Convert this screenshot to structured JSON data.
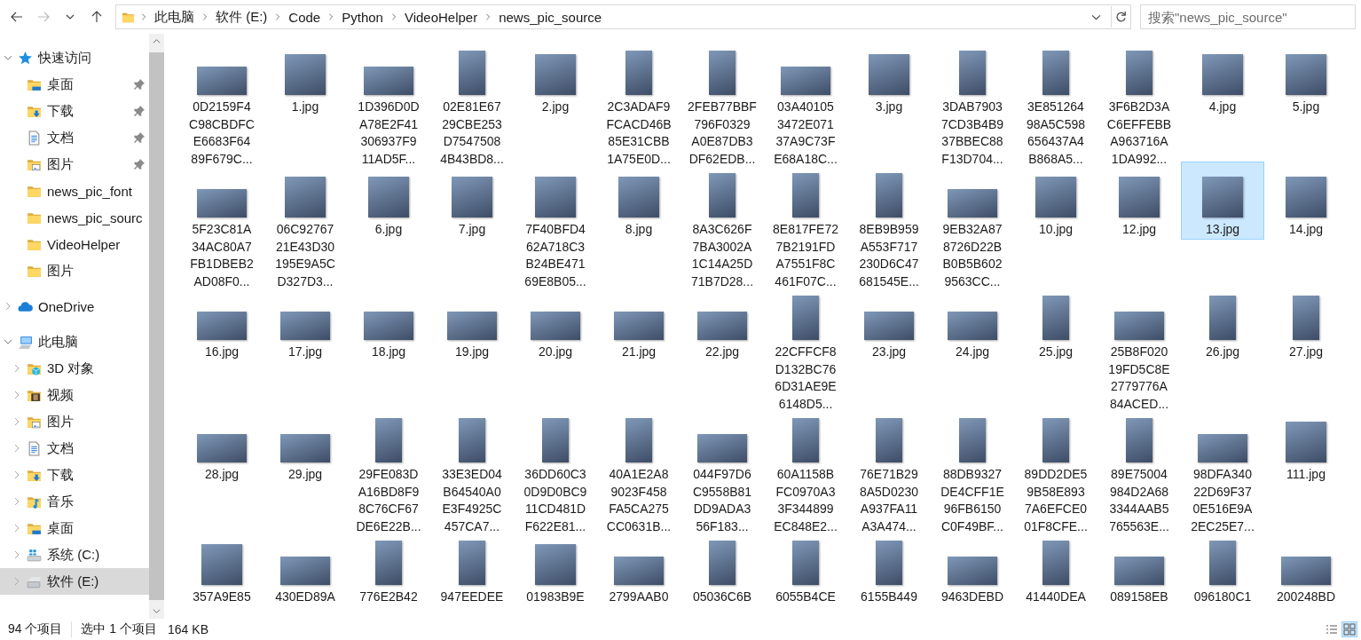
{
  "nav_buttons": [
    {
      "kind": "back",
      "disabled": false
    },
    {
      "kind": "forward",
      "disabled": true
    },
    {
      "kind": "recent",
      "disabled": false
    },
    {
      "kind": "up",
      "disabled": false
    }
  ],
  "address_bar": {
    "segments": [
      "此电脑",
      "软件 (E:)",
      "Code",
      "Python",
      "VideoHelper",
      "news_pic_source"
    ]
  },
  "search": {
    "placeholder": "搜索\"news_pic_source\""
  },
  "sidebar": {
    "sections": [
      {
        "label": "快速访问",
        "kind": "star",
        "expanded": true,
        "selected": false,
        "children": [
          {
            "label": "桌面",
            "kind": "desktop",
            "pinned": true,
            "selected": false
          },
          {
            "label": "下载",
            "kind": "downloads",
            "pinned": true,
            "selected": false
          },
          {
            "label": "文档",
            "kind": "documents",
            "pinned": true,
            "selected": false
          },
          {
            "label": "图片",
            "kind": "pictures",
            "pinned": true,
            "selected": false
          },
          {
            "label": "news_pic_font",
            "kind": "folder",
            "pinned": false,
            "selected": false
          },
          {
            "label": "news_pic_sourc",
            "kind": "folder",
            "pinned": false,
            "selected": false
          },
          {
            "label": "VideoHelper",
            "kind": "folder",
            "pinned": false,
            "selected": false
          },
          {
            "label": "图片",
            "kind": "folder",
            "pinned": false,
            "selected": false
          }
        ]
      },
      {
        "label": "OneDrive",
        "kind": "cloud",
        "expanded": false,
        "selected": false
      },
      {
        "label": "此电脑",
        "kind": "pc",
        "expanded": true,
        "selected": false,
        "children": [
          {
            "label": "3D 对象",
            "kind": "objects",
            "expanded": false,
            "selected": false
          },
          {
            "label": "视频",
            "kind": "videos",
            "expanded": false,
            "selected": false
          },
          {
            "label": "图片",
            "kind": "pictures",
            "expanded": false,
            "selected": false
          },
          {
            "label": "文档",
            "kind": "documents",
            "expanded": false,
            "selected": false
          },
          {
            "label": "下载",
            "kind": "downloads",
            "expanded": false,
            "selected": false
          },
          {
            "label": "音乐",
            "kind": "music",
            "expanded": false,
            "selected": false
          },
          {
            "label": "桌面",
            "kind": "desktop",
            "expanded": false,
            "selected": false
          },
          {
            "label": "系统 (C:)",
            "kind": "sysdrive",
            "expanded": false,
            "selected": false
          },
          {
            "label": "软件 (E:)",
            "kind": "drive",
            "expanded": false,
            "selected": true
          }
        ]
      }
    ]
  },
  "files": [
    {
      "name": "0D2159F4\nC98CBDFC\nE6683F64\n89F679C...",
      "kind": "landscape",
      "selected": false
    },
    {
      "name": "1.jpg",
      "kind": "square",
      "selected": false
    },
    {
      "name": "1D396D0D\nA78E2F41\n306937F9\n11AD5F...",
      "kind": "landscape",
      "selected": false
    },
    {
      "name": "02E81E67\n29CBE253\nD7547508\n4B43BD8...",
      "kind": "portrait",
      "selected": false
    },
    {
      "name": "2.jpg",
      "kind": "square",
      "selected": false
    },
    {
      "name": "2C3ADAF9\nFCACD46B\n85E31CBB\n1A75E0D...",
      "kind": "portrait",
      "selected": false
    },
    {
      "name": "2FEB77BBF\n796F0329\nA0E87DB3\nDF62EDB...",
      "kind": "portrait",
      "selected": false
    },
    {
      "name": "03A40105\n3472E071\n37A9C73F\nE68A18C...",
      "kind": "landscape",
      "selected": false
    },
    {
      "name": "3.jpg",
      "kind": "square",
      "selected": false
    },
    {
      "name": "3DAB7903\n7CD3B4B9\n37BBEC88\nF13D704...",
      "kind": "portrait",
      "selected": false
    },
    {
      "name": "3E851264\n98A5C598\n656437A4\nB868A5...",
      "kind": "portrait",
      "selected": false
    },
    {
      "name": "3F6B2D3A\nC6EFFEBB\nA963716A\n1DA992...",
      "kind": "portrait",
      "selected": false
    },
    {
      "name": "4.jpg",
      "kind": "square",
      "selected": false
    },
    {
      "name": "5.jpg",
      "kind": "square",
      "selected": false
    },
    {
      "name": "5F23C81A\n34AC80A7\nFB1DBEB2\nAD08F0...",
      "kind": "landscape",
      "selected": false
    },
    {
      "name": "06C92767\n21E43D30\n195E9A5C\nD327D3...",
      "kind": "square",
      "selected": false
    },
    {
      "name": "6.jpg",
      "kind": "square",
      "selected": false
    },
    {
      "name": "7.jpg",
      "kind": "square",
      "selected": false
    },
    {
      "name": "7F40BFD4\n62A718C3\nB24BE471\n69E8B05...",
      "kind": "square",
      "selected": false
    },
    {
      "name": "8.jpg",
      "kind": "square",
      "selected": false
    },
    {
      "name": "8A3C626F\n7BA3002A\n1C14A25D\n71B7D28...",
      "kind": "portrait",
      "selected": false
    },
    {
      "name": "8E817FE72\n7B2191FD\nA7551F8C\n461F07C...",
      "kind": "portrait",
      "selected": false
    },
    {
      "name": "8EB9B959\nA553F717\n230D6C47\n681545E...",
      "kind": "portrait",
      "selected": false
    },
    {
      "name": "9EB32A87\n8726D22B\nB0B5B602\n9563CC...",
      "kind": "landscape",
      "selected": false
    },
    {
      "name": "10.jpg",
      "kind": "square",
      "selected": false
    },
    {
      "name": "12.jpg",
      "kind": "square",
      "selected": false
    },
    {
      "name": "13.jpg",
      "kind": "square",
      "selected": true
    },
    {
      "name": "14.jpg",
      "kind": "square",
      "selected": false
    },
    {
      "name": "16.jpg",
      "kind": "landscape",
      "selected": false
    },
    {
      "name": "17.jpg",
      "kind": "landscape",
      "selected": false
    },
    {
      "name": "18.jpg",
      "kind": "landscape",
      "selected": false
    },
    {
      "name": "19.jpg",
      "kind": "landscape",
      "selected": false
    },
    {
      "name": "20.jpg",
      "kind": "landscape",
      "selected": false
    },
    {
      "name": "21.jpg",
      "kind": "landscape",
      "selected": false
    },
    {
      "name": "22.jpg",
      "kind": "landscape",
      "selected": false
    },
    {
      "name": "22CFFCF8\nD132BC76\n6D31AE9E\n6148D5...",
      "kind": "portrait",
      "selected": false
    },
    {
      "name": "23.jpg",
      "kind": "landscape",
      "selected": false
    },
    {
      "name": "24.jpg",
      "kind": "landscape",
      "selected": false
    },
    {
      "name": "25.jpg",
      "kind": "portrait",
      "selected": false
    },
    {
      "name": "25B8F020\n19FD5C8E\n2779776A\n84ACED...",
      "kind": "landscape",
      "selected": false
    },
    {
      "name": "26.jpg",
      "kind": "portrait",
      "selected": false
    },
    {
      "name": "27.jpg",
      "kind": "portrait",
      "selected": false
    },
    {
      "name": "28.jpg",
      "kind": "landscape",
      "selected": false
    },
    {
      "name": "29.jpg",
      "kind": "landscape",
      "selected": false
    },
    {
      "name": "29FE083D\nA16BD8F9\n8C76CF67\nDE6E22B...",
      "kind": "portrait",
      "selected": false
    },
    {
      "name": "33E3ED04\nB64540A0\nE3F4925C\n457CA7...",
      "kind": "portrait",
      "selected": false
    },
    {
      "name": "36DD60C3\n0D9D0BC9\n11CD481D\nF622E81...",
      "kind": "portrait",
      "selected": false
    },
    {
      "name": "40A1E2A8\n9023F458\nFA5CA275\nCC0631B...",
      "kind": "portrait",
      "selected": false
    },
    {
      "name": "044F97D6\nC9558B81\nDD9ADA3\n56F183...",
      "kind": "landscape",
      "selected": false
    },
    {
      "name": "60A1158B\nFC0970A3\n3F344899\nEC848E2...",
      "kind": "portrait",
      "selected": false
    },
    {
      "name": "76E71B29\n8A5D0230\nA937FA11\nA3A474...",
      "kind": "portrait",
      "selected": false
    },
    {
      "name": "88DB9327\nDE4CFF1E\n96FB6150\nC0F49BF...",
      "kind": "portrait",
      "selected": false
    },
    {
      "name": "89DD2DE5\n9B58E893\n7A6EFCE0\n01F8CFE...",
      "kind": "portrait",
      "selected": false
    },
    {
      "name": "89E75004\n984D2A68\n3344AAB5\n765563E...",
      "kind": "portrait",
      "selected": false
    },
    {
      "name": "98DFA340\n22D69F37\n0E516E9A\n2EC25E7...",
      "kind": "landscape",
      "selected": false
    },
    {
      "name": "111.jpg",
      "kind": "square",
      "selected": false
    },
    {
      "name": "357A9E85",
      "kind": "square",
      "selected": false
    },
    {
      "name": "430ED89A",
      "kind": "landscape",
      "selected": false
    },
    {
      "name": "776E2B42",
      "kind": "portrait",
      "selected": false
    },
    {
      "name": "947EEDEE",
      "kind": "portrait",
      "selected": false
    },
    {
      "name": "01983B9E",
      "kind": "square",
      "selected": false
    },
    {
      "name": "2799AAB0",
      "kind": "landscape",
      "selected": false
    },
    {
      "name": "05036C6B",
      "kind": "portrait",
      "selected": false
    },
    {
      "name": "6055B4CE",
      "kind": "portrait",
      "selected": false
    },
    {
      "name": "6155B449",
      "kind": "portrait",
      "selected": false
    },
    {
      "name": "9463DEBD",
      "kind": "landscape",
      "selected": false
    },
    {
      "name": "41440DEA",
      "kind": "portrait",
      "selected": false
    },
    {
      "name": "089158EB",
      "kind": "landscape",
      "selected": false
    },
    {
      "name": "096180C1",
      "kind": "portrait",
      "selected": false
    },
    {
      "name": "200248BD",
      "kind": "landscape",
      "selected": false
    }
  ],
  "status_bar": {
    "item_count": "94 个项目",
    "selection": "选中 1 个项目",
    "size": "164 KB",
    "views": [
      {
        "kind": "details",
        "selected": false
      },
      {
        "kind": "large_icons",
        "selected": true
      }
    ]
  }
}
